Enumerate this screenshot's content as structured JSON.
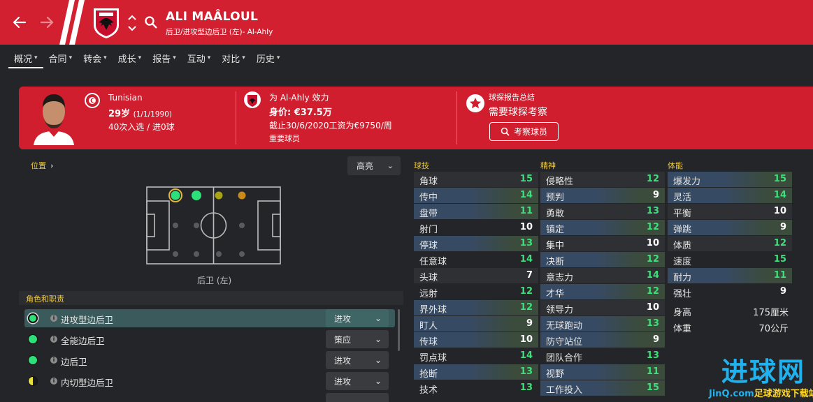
{
  "header": {
    "player_name": "ALI MAÂLOUL",
    "subtitle": "后卫/进攻型边后卫 (左)- Al-Ahly",
    "bg_color": "#d22030"
  },
  "tabs": [
    {
      "label": "概况",
      "active": true
    },
    {
      "label": "合同"
    },
    {
      "label": "转会"
    },
    {
      "label": "成长"
    },
    {
      "label": "报告"
    },
    {
      "label": "互动"
    },
    {
      "label": "对比"
    },
    {
      "label": "历史"
    }
  ],
  "card": {
    "nationality": "Tunisian",
    "age": "29岁",
    "dob": "(1/1/1990)",
    "caps": "40次入选 / 进0球",
    "plays_for": "为 Al-Ahly 效力",
    "value": "身价: €37.5万",
    "wage": "截止30/6/2020工资为€9750/周",
    "squad_status": "重要球员",
    "scout_title": "球探报告总结",
    "scout_need": "需要球探考察",
    "scout_button": "考察球员"
  },
  "position": {
    "label": "位置",
    "highlight_dropdown": "高亮",
    "caption": "后卫 (左)"
  },
  "roles": {
    "title": "角色和职责",
    "items": [
      {
        "name": "进攻型边后卫",
        "duty": "进攻",
        "selected": true,
        "rating": "full"
      },
      {
        "name": "全能边后卫",
        "duty": "策应",
        "rating": "full"
      },
      {
        "name": "边后卫",
        "duty": "进攻",
        "rating": "full"
      },
      {
        "name": "内切型边后卫",
        "duty": "进攻",
        "rating": "half"
      }
    ]
  },
  "attributes": {
    "technical_title": "球技",
    "mental_title": "精神",
    "physical_title": "体能",
    "technical": [
      {
        "name": "角球",
        "value": "15",
        "color": "green"
      },
      {
        "name": "传中",
        "value": "14",
        "color": "green"
      },
      {
        "name": "盘带",
        "value": "11",
        "color": "green"
      },
      {
        "name": "射门",
        "value": "10",
        "color": "white"
      },
      {
        "name": "停球",
        "value": "13",
        "color": "green"
      },
      {
        "name": "任意球",
        "value": "14",
        "color": "green"
      },
      {
        "name": "头球",
        "value": "7",
        "color": "white"
      },
      {
        "name": "远射",
        "value": "12",
        "color": "green"
      },
      {
        "name": "界外球",
        "value": "12",
        "color": "green"
      },
      {
        "name": "盯人",
        "value": "9",
        "color": "white"
      },
      {
        "name": "传球",
        "value": "10",
        "color": "white"
      },
      {
        "name": "罚点球",
        "value": "14",
        "color": "green"
      },
      {
        "name": "抢断",
        "value": "13",
        "color": "green"
      },
      {
        "name": "技术",
        "value": "13",
        "color": "green"
      }
    ],
    "mental": [
      {
        "name": "侵略性",
        "value": "12",
        "color": "green"
      },
      {
        "name": "预判",
        "value": "9",
        "color": "white"
      },
      {
        "name": "勇敢",
        "value": "13",
        "color": "green"
      },
      {
        "name": "镇定",
        "value": "12",
        "color": "green"
      },
      {
        "name": "集中",
        "value": "10",
        "color": "white"
      },
      {
        "name": "决断",
        "value": "12",
        "color": "green"
      },
      {
        "name": "意志力",
        "value": "14",
        "color": "green"
      },
      {
        "name": "才华",
        "value": "12",
        "color": "green"
      },
      {
        "name": "领导力",
        "value": "10",
        "color": "white"
      },
      {
        "name": "无球跑动",
        "value": "13",
        "color": "green"
      },
      {
        "name": "防守站位",
        "value": "9",
        "color": "white"
      },
      {
        "name": "团队合作",
        "value": "13",
        "color": "green"
      },
      {
        "name": "视野",
        "value": "11",
        "color": "green"
      },
      {
        "name": "工作投入",
        "value": "15",
        "color": "green"
      }
    ],
    "physical": [
      {
        "name": "爆发力",
        "value": "15",
        "color": "green"
      },
      {
        "name": "灵活",
        "value": "14",
        "color": "green"
      },
      {
        "name": "平衡",
        "value": "10",
        "color": "white"
      },
      {
        "name": "弹跳",
        "value": "9",
        "color": "white"
      },
      {
        "name": "体质",
        "value": "12",
        "color": "green"
      },
      {
        "name": "速度",
        "value": "15",
        "color": "green"
      },
      {
        "name": "耐力",
        "value": "11",
        "color": "green"
      },
      {
        "name": "强壮",
        "value": "9",
        "color": "white"
      }
    ],
    "height_label": "身高",
    "height_value": "175厘米",
    "weight_label": "体重",
    "weight_value": "70公斤"
  },
  "watermark": {
    "big": "进球网",
    "small_a": "JinQ.com",
    "small_b": "足球游戏下载站"
  },
  "colors": {
    "green": "#3de07a",
    "white": "#ffffff",
    "accent_yellow": "#f0c93a",
    "club_red": "#d01e2e"
  }
}
